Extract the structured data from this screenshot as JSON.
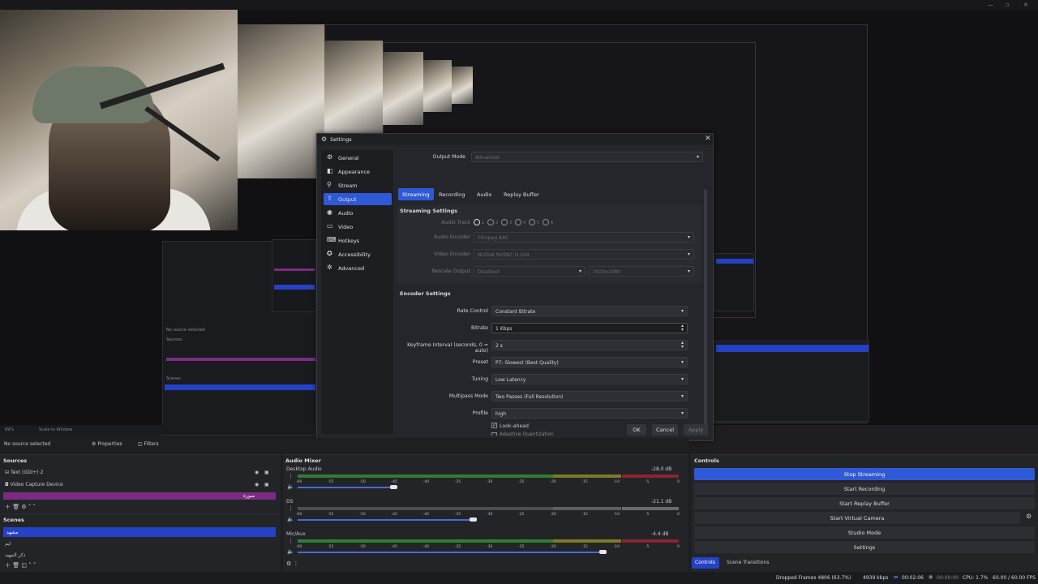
{
  "settings": {
    "title": "Settings",
    "nav": [
      {
        "label": "General",
        "icon": "gear-icon",
        "glyph": "⚙"
      },
      {
        "label": "Appearance",
        "icon": "paint-icon",
        "glyph": "◧"
      },
      {
        "label": "Stream",
        "icon": "antenna-icon",
        "glyph": "⚲"
      },
      {
        "label": "Output",
        "icon": "output-icon",
        "glyph": "⇪"
      },
      {
        "label": "Audio",
        "icon": "speaker-icon",
        "glyph": "◉"
      },
      {
        "label": "Video",
        "icon": "monitor-icon",
        "glyph": "▭"
      },
      {
        "label": "Hotkeys",
        "icon": "keyboard-icon",
        "glyph": "⌨"
      },
      {
        "label": "Accessibility",
        "icon": "accessibility-icon",
        "glyph": "✪"
      },
      {
        "label": "Advanced",
        "icon": "wrench-icon",
        "glyph": "✲"
      }
    ],
    "selected_nav": "Output",
    "output_mode_label": "Output Mode",
    "output_mode_value": "Advanced",
    "tabs": [
      "Streaming",
      "Recording",
      "Audio",
      "Replay Buffer"
    ],
    "selected_tab": "Streaming",
    "streaming_settings_title": "Streaming Settings",
    "audio_track_label": "Audio Track",
    "audio_tracks": [
      "1",
      "2",
      "3",
      "4",
      "5",
      "6"
    ],
    "audio_encoder_label": "Audio Encoder",
    "audio_encoder_value": "FFmpeg AAC",
    "video_encoder_label": "Video Encoder",
    "video_encoder_value": "NVIDIA NVENC H.264",
    "rescale_output_label": "Rescale Output",
    "rescale_output_value": "Disabled",
    "rescale_resolution_value": "1920x1080",
    "encoder_settings_title": "Encoder Settings",
    "rate_control_label": "Rate Control",
    "rate_control_value": "Constant Bitrate",
    "bitrate_label": "Bitrate",
    "bitrate_value": "1 Kbps",
    "keyframe_label": "Keyframe Interval (seconds, 0 = auto)",
    "keyframe_value": "2 s",
    "preset_label": "Preset",
    "preset_value": "P7: Slowest (Best Quality)",
    "tuning_label": "Tuning",
    "tuning_value": "Low Latency",
    "multipass_label": "Multipass Mode",
    "multipass_value": "Two Passes (Full Resolution)",
    "profile_label": "Profile",
    "profile_value": "high",
    "lookahead_label": "Look-ahead",
    "adaptive_label": "Adaptive Quantization",
    "ok": "OK",
    "cancel": "Cancel",
    "apply": "Apply"
  },
  "preview": {
    "zoom_label": "69%",
    "scale_label": "Scale to Window"
  },
  "source_toolbar": {
    "no_source": "No source selected",
    "properties": "Properties",
    "filters": "Filters"
  },
  "sources": {
    "title": "Sources",
    "items": [
      "Text (GDI+) 2",
      "Video Capture Device",
      "صورة"
    ]
  },
  "scenes": {
    "title": "Scenes",
    "items": [
      "مشهد",
      "ايم",
      "ذكر المهيد"
    ]
  },
  "audio_mixer": {
    "title": "Audio Mixer",
    "channels": [
      {
        "name": "Desktop Audio",
        "db": "-28.0 dB",
        "level": 0.25
      },
      {
        "name": "DS",
        "db": "-21.1 dB",
        "level": 0.46
      },
      {
        "name": "Mic/Aux",
        "db": "-4.4 dB",
        "level": 0.8
      }
    ],
    "scale": [
      "-60",
      "-55",
      "-50",
      "-45",
      "-40",
      "-35",
      "-30",
      "-25",
      "-20",
      "-15",
      "-10",
      "-5",
      "0"
    ]
  },
  "controls": {
    "title": "Controls",
    "buttons": [
      "Stop Streaming",
      "Start Recording",
      "Start Replay Buffer",
      "Start Virtual Camera",
      "Studio Mode",
      "Settings"
    ]
  },
  "dock_tabs": [
    "Controls",
    "Scene Transitions"
  ],
  "status": {
    "dropped_frames": "Dropped Frames 4806 (63.7%)",
    "kbps": "4939 kbps",
    "stream_time": "00:02:06",
    "rec_time": "00:00:00",
    "cpu": "CPU: 1.7%",
    "fps": "60.00 / 60.00 FPS"
  },
  "accent_color": "#2f59d6"
}
